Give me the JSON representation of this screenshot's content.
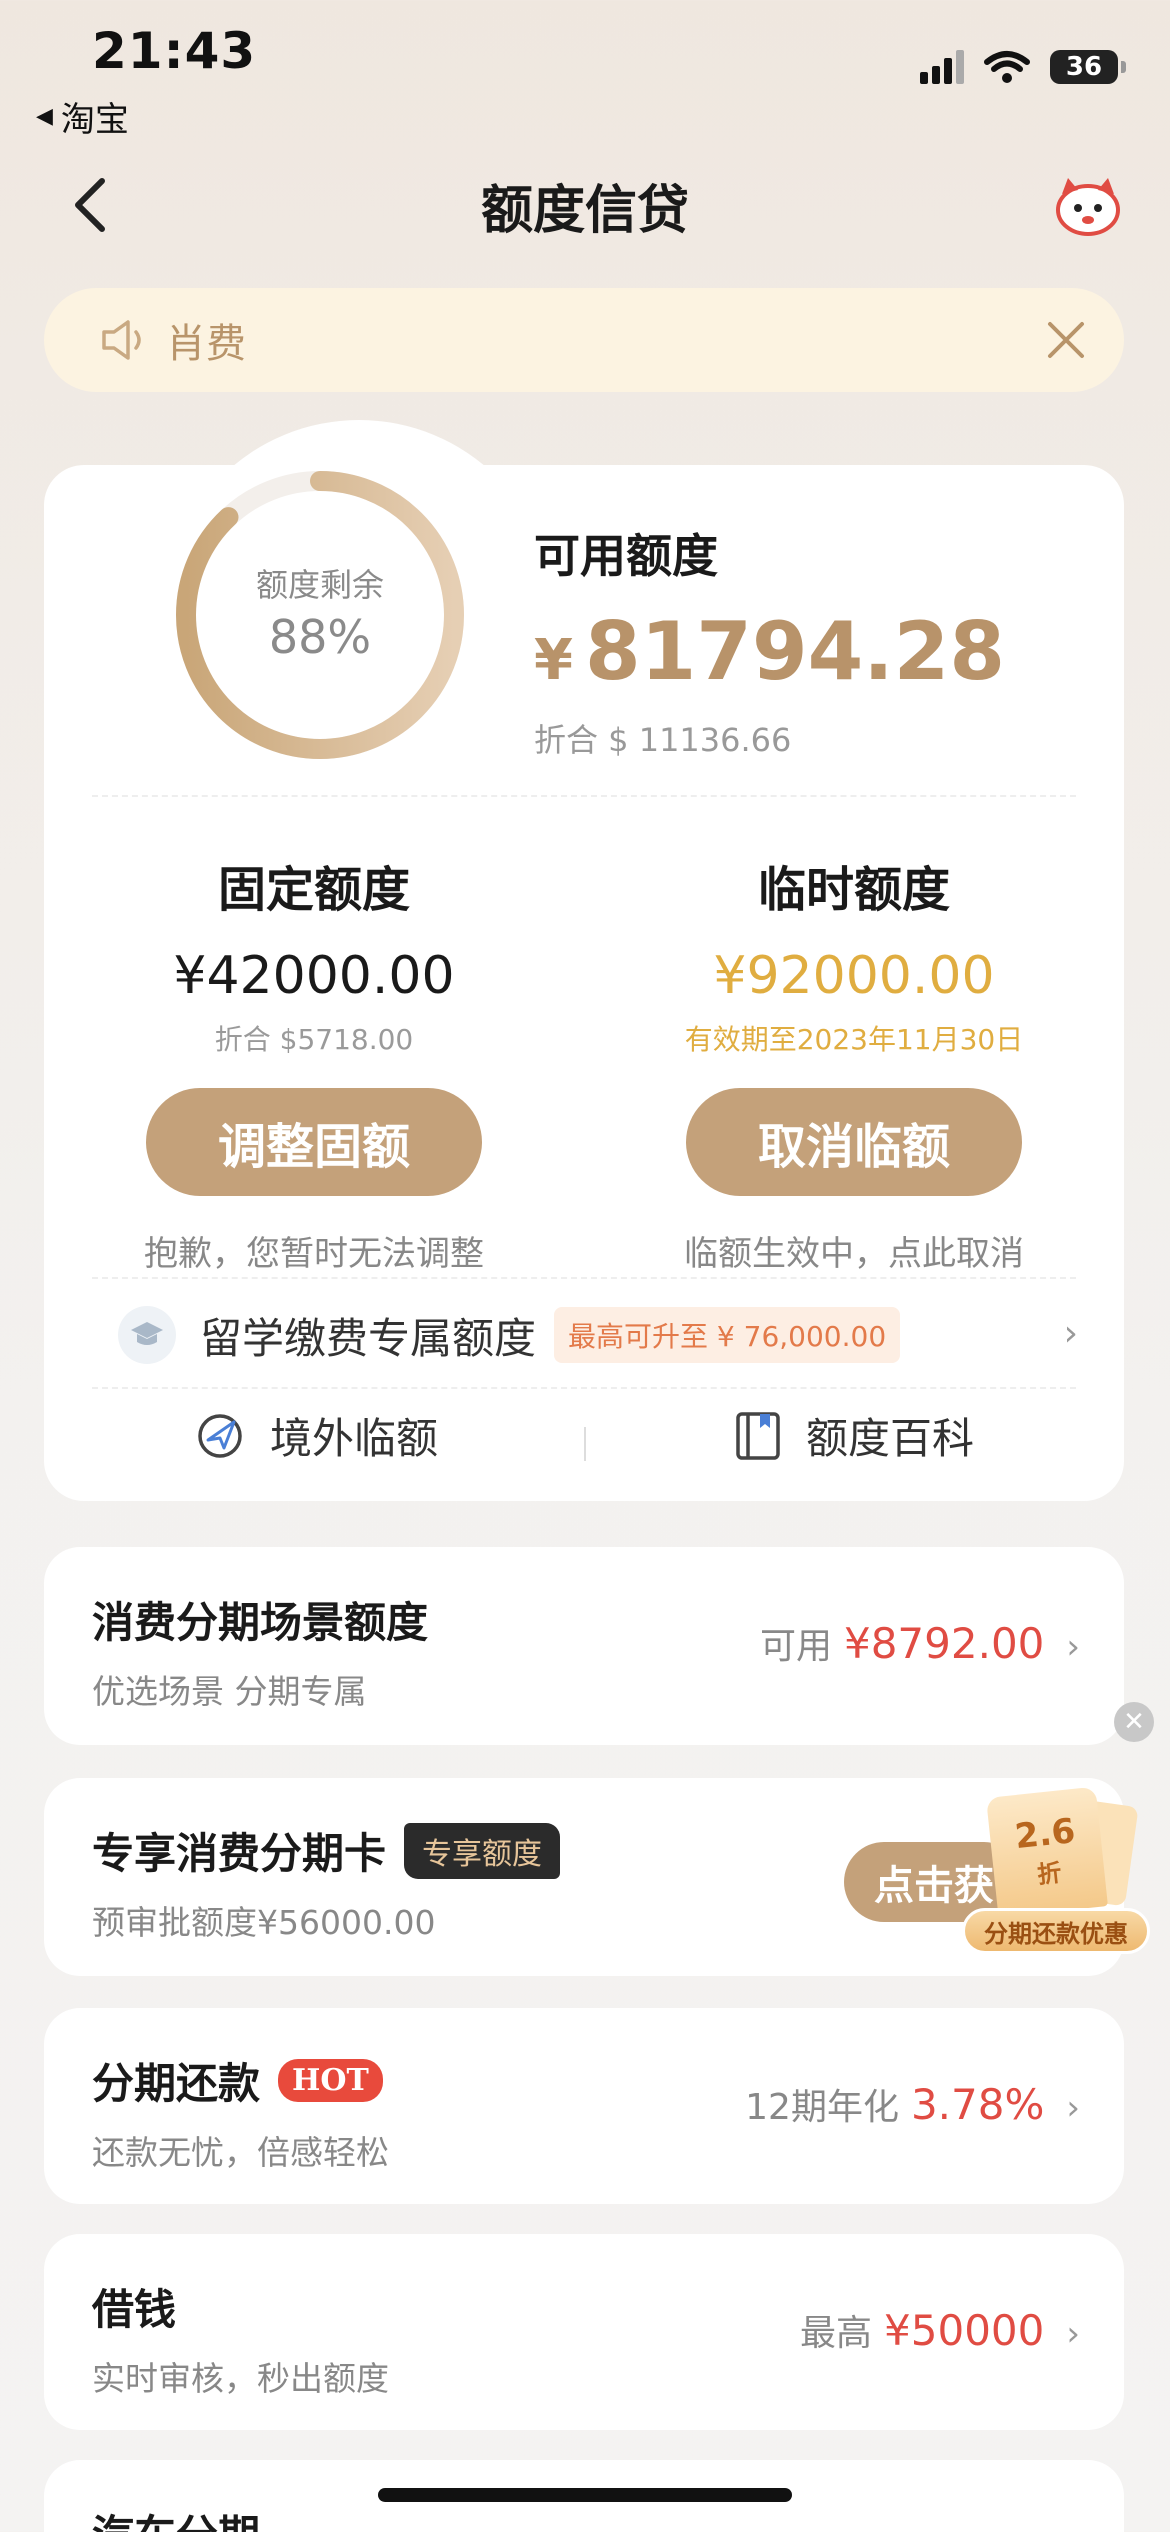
{
  "status_bar": {
    "time": "21:43",
    "back_app": "淘宝",
    "battery": "36"
  },
  "nav": {
    "title": "额度信贷",
    "mascot_icon": "mascot-avatar-icon"
  },
  "notice": {
    "text": "肖费"
  },
  "quota": {
    "ring_label": "额度剩余",
    "ring_percent": "88%",
    "ring_fraction": 0.88,
    "available_label": "可用额度",
    "currency": "¥",
    "available_amount": "81794.28",
    "available_usd": "折合 $ 11136.66",
    "fixed": {
      "title": "固定额度",
      "amount": "¥42000.00",
      "sub": "折合 $5718.00",
      "button": "调整固额",
      "note": "抱歉，您暂时无法调整"
    },
    "temporary": {
      "title": "临时额度",
      "amount": "¥92000.00",
      "sub": "有效期至2023年11月30日",
      "button": "取消临额",
      "note": "临额生效中，点此取消"
    },
    "study": {
      "label": "留学缴费专属额度",
      "badge": "最高可升至 ¥ 76,000.00"
    },
    "links": {
      "overseas": "境外临额",
      "wiki": "额度百科"
    }
  },
  "list": {
    "scene": {
      "title": "消费分期场景额度",
      "sub": "优选场景 分期专属",
      "right_label": "可用",
      "right_value": "¥8792.00"
    },
    "card": {
      "title": "专享消费分期卡",
      "badge": "专享额度",
      "sub": "预审批额度¥56000.00",
      "button": "点击获"
    },
    "installment": {
      "title": "分期还款",
      "badge": "HOT",
      "sub": "还款无忧，倍感轻松",
      "right_label": "12期年化",
      "right_value": "3.78%"
    },
    "borrow": {
      "title": "借钱",
      "sub": "实时审核，秒出额度",
      "right_label": "最高",
      "right_value": "¥50000"
    },
    "car": {
      "title": "汽车分期"
    }
  },
  "promo": {
    "discount": "2.6",
    "discount_unit": "折",
    "label": "分期还款优惠"
  },
  "colors": {
    "gold": "#c4a17a",
    "amount_gold": "#b8936a",
    "temp_gold": "#e0ad40",
    "red": "#e04c43"
  }
}
